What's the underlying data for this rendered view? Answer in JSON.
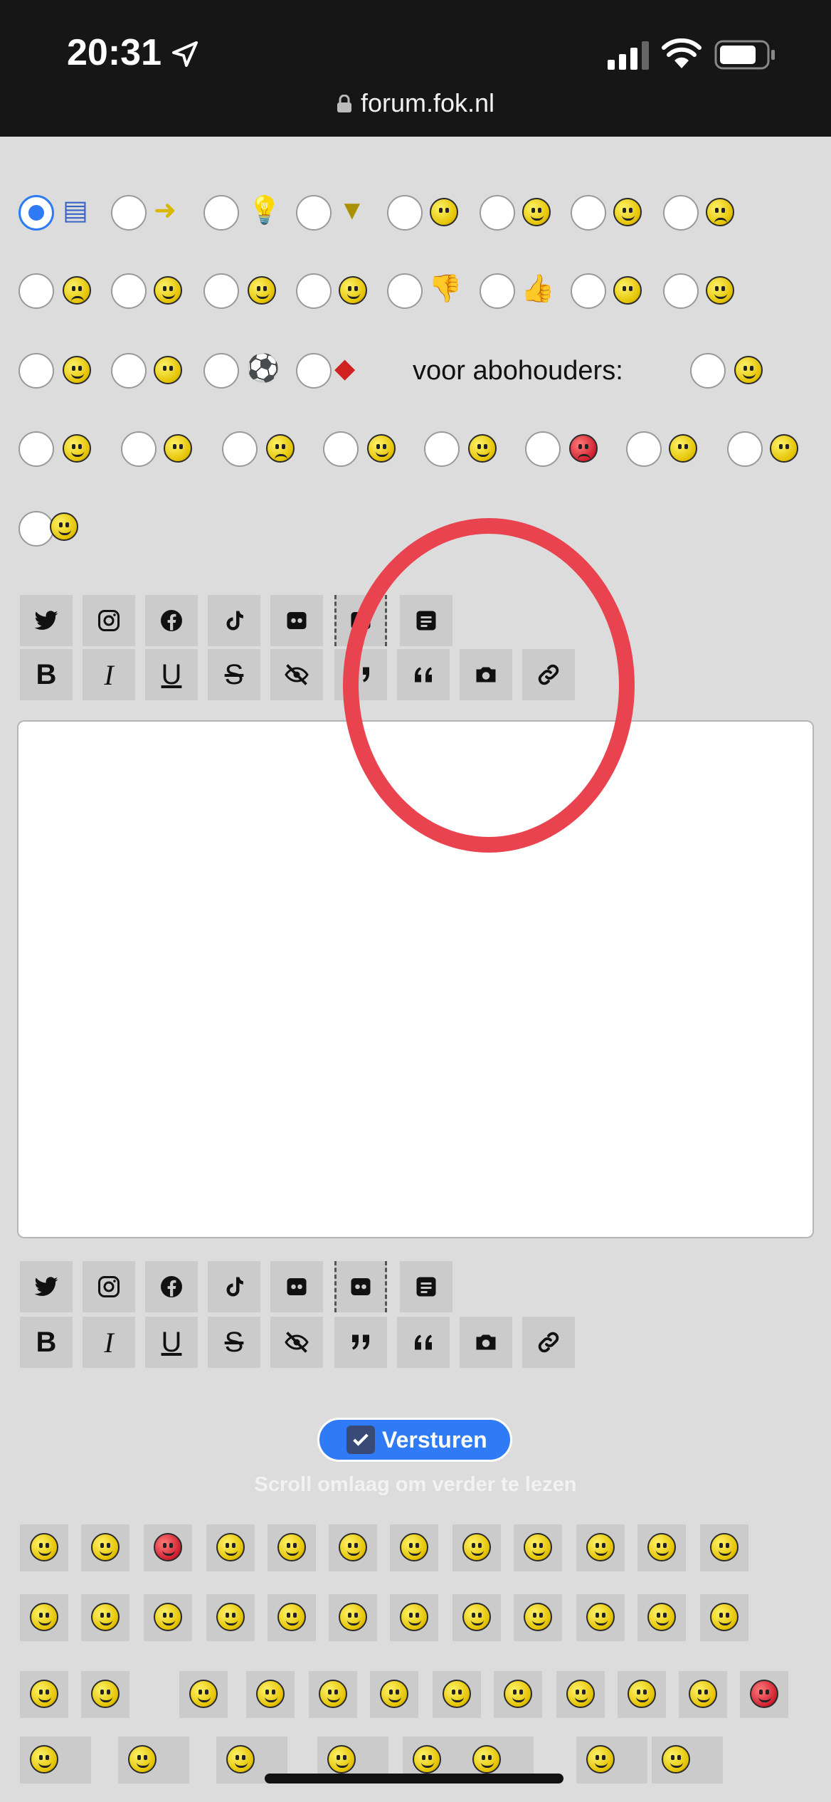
{
  "status_bar": {
    "time": "20:31",
    "url": "forum.fok.nl"
  },
  "radio_rows": {
    "abo_label": "voor abohouders:"
  },
  "toolbar": {
    "social": [
      "twitter",
      "instagram",
      "facebook",
      "tiktok",
      "flickr",
      "flickr-alt",
      "document"
    ],
    "format": {
      "bold": "B",
      "italic": "I",
      "underline": "U",
      "strike": "S"
    }
  },
  "textarea": {
    "value": ""
  },
  "send": {
    "label": "Versturen",
    "checked": true
  },
  "scroll_hint": "Scroll omlaag om verder te lezen",
  "colors": {
    "accent": "#2f7bf5",
    "annotation": "#e94350",
    "background": "#dcdcdc"
  }
}
